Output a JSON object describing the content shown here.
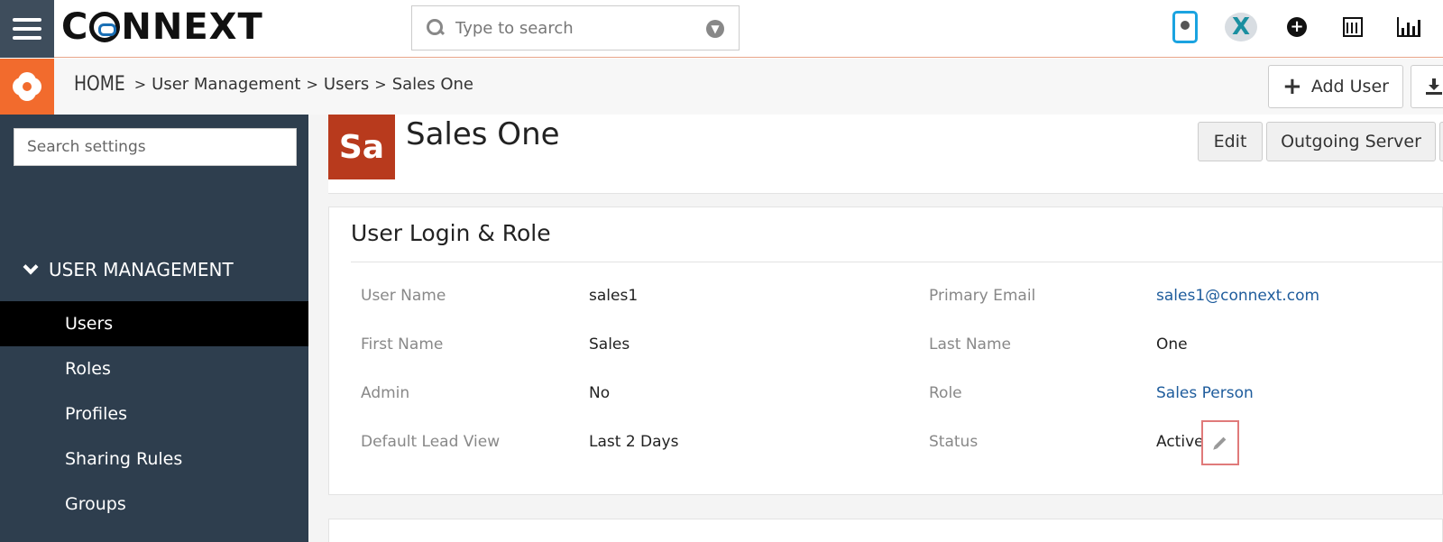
{
  "topbar": {
    "menu_icon": "hamburger-icon",
    "logo_text_left": "C",
    "logo_text_right": "NNEXT",
    "search_placeholder": "Type to search",
    "icons": [
      "mobile-app-icon",
      "connext-x-icon",
      "plus-circle-icon",
      "calendar-icon",
      "chart-icon"
    ],
    "x_letter": "X",
    "plus_glyph": "+"
  },
  "breadcrumb": {
    "gear_icon": "gear-icon",
    "home": "HOME",
    "separator": ">",
    "items": [
      "User Management",
      "Users",
      "Sales One"
    ]
  },
  "actions": {
    "add_user_label": "Add User",
    "add_user_glyph": "+"
  },
  "sidebar": {
    "search_placeholder": "Search settings",
    "section_label": "USER MANAGEMENT",
    "items": [
      {
        "label": "Users",
        "active": true
      },
      {
        "label": "Roles",
        "active": false
      },
      {
        "label": "Profiles",
        "active": false
      },
      {
        "label": "Sharing Rules",
        "active": false
      },
      {
        "label": "Groups",
        "active": false
      }
    ]
  },
  "user": {
    "initials": "Sa",
    "full_name": "Sales One",
    "edit_label": "Edit",
    "outgoing_server_label": "Outgoing Server"
  },
  "login_role": {
    "title": "User Login & Role",
    "fields": {
      "user_name": {
        "label": "User Name",
        "value": "sales1"
      },
      "primary_email": {
        "label": "Primary Email",
        "value": "sales1@connext.com"
      },
      "first_name": {
        "label": "First Name",
        "value": "Sales"
      },
      "last_name": {
        "label": "Last Name",
        "value": "One"
      },
      "admin": {
        "label": "Admin",
        "value": "No"
      },
      "role": {
        "label": "Role",
        "value": "Sales Person"
      },
      "default_lead_view": {
        "label": "Default Lead View",
        "value": "Last 2 Days"
      },
      "status": {
        "label": "Status",
        "value": "Active"
      }
    }
  },
  "colors": {
    "sidebar_bg": "#2e3e4e",
    "accent_orange": "#f26b2d",
    "avatar_bg": "#b83a1d",
    "link_blue": "#1e5c9c",
    "highlight_red": "#e07a7a"
  }
}
